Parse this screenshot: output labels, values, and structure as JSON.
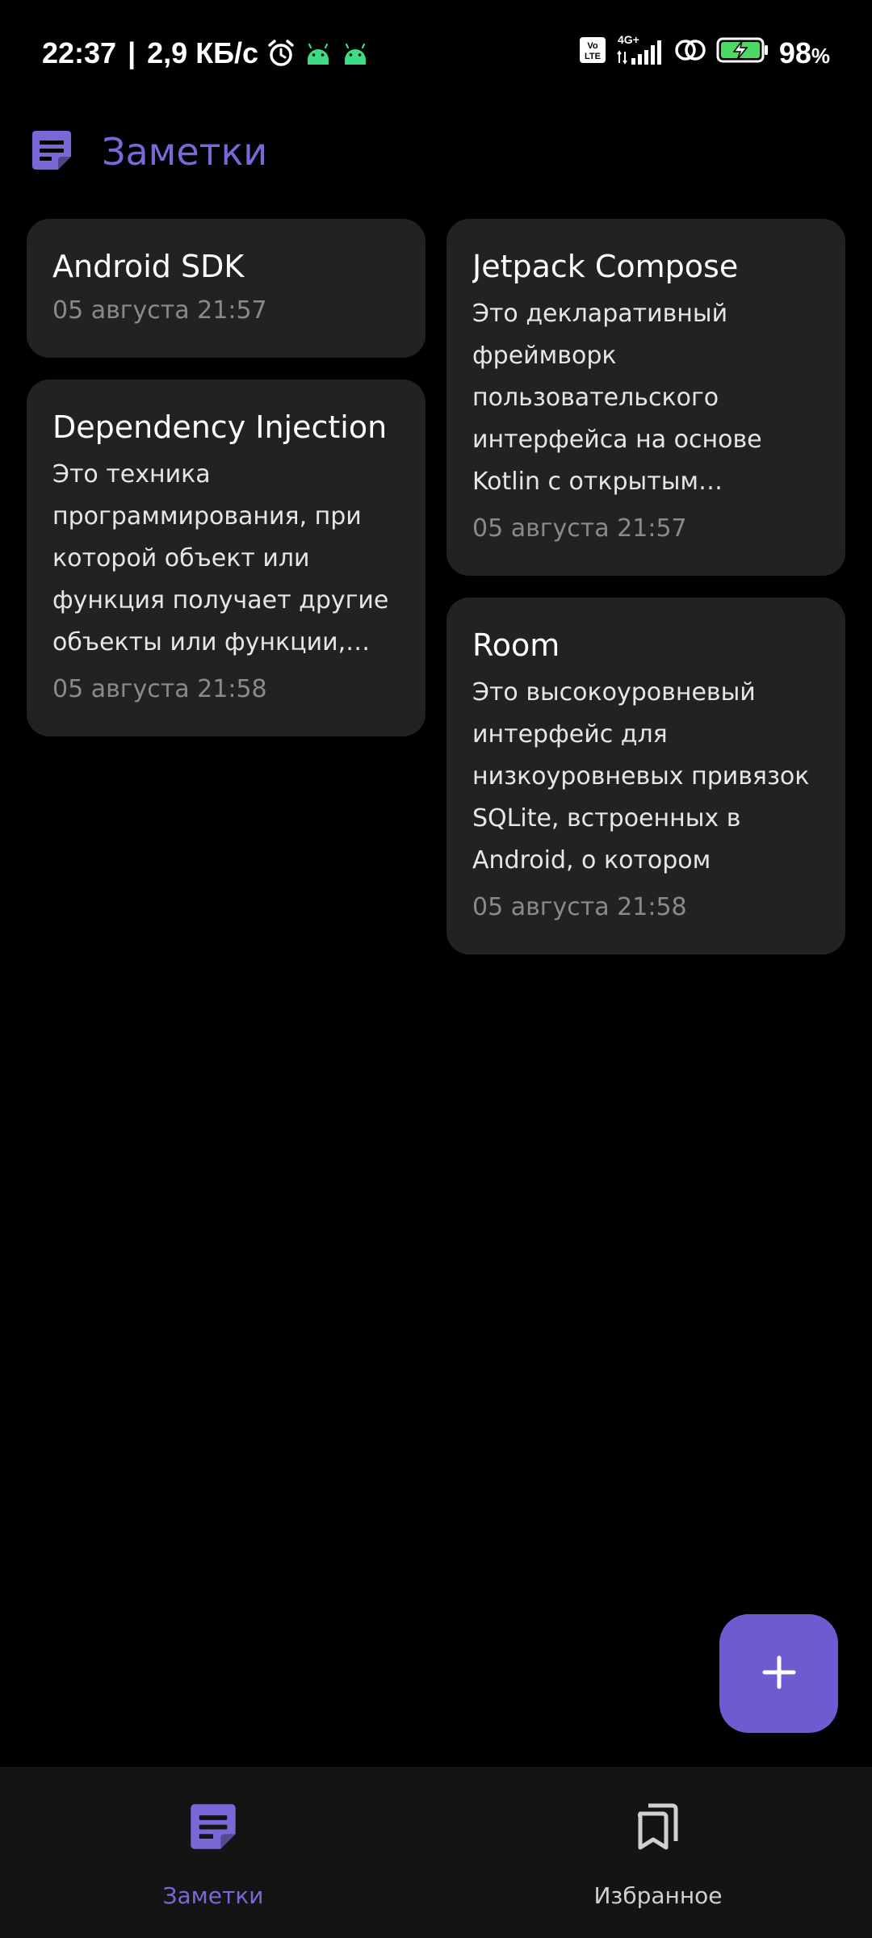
{
  "status_bar": {
    "time": "22:37",
    "separator": "|",
    "speed": "2,9 КБ/с",
    "network": "4G+",
    "volte": "Vo LTE",
    "battery_percent": "98",
    "battery_percent_sign": "%",
    "icons": [
      "alarm-icon",
      "android-icon",
      "android-icon",
      "volte-icon",
      "signal-icon",
      "link-icon",
      "battery-charging-icon"
    ]
  },
  "app_bar": {
    "title": "Заметки",
    "logo_icon": "note-icon",
    "accent_color": "#7b67d8"
  },
  "notes": {
    "left": [
      {
        "title": "Android SDK",
        "body": "",
        "date": "05 августа 21:57"
      },
      {
        "title": "Dependency Injection",
        "body": "Это техника программирования, при которой объект или функция получает другие объекты или функции, которые ему необходимы",
        "date": "05 августа 21:58"
      }
    ],
    "right": [
      {
        "title": "Jetpack Compose",
        "body": "Это декларативный фреймворк пользовательского интерфейса на основе Kotlin с открытым исходным кодом",
        "date": "05 августа 21:57"
      },
      {
        "title": "Room",
        "body": "Это высокоуровневый интерфейс для низкоуровневых привязок SQLite, встроенных в Android, о котором",
        "date": "05 августа 21:58"
      }
    ]
  },
  "fab": {
    "icon": "plus-icon",
    "color": "#6e5bd2"
  },
  "bottom_nav": {
    "items": [
      {
        "label": "Заметки",
        "icon": "note-icon",
        "active": true
      },
      {
        "label": "Избранное",
        "icon": "bookmarks-icon",
        "active": false
      }
    ]
  }
}
